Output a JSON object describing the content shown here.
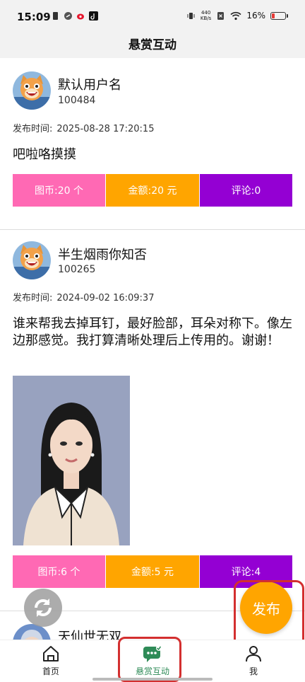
{
  "status_bar": {
    "time": "15:09",
    "net_speed_value": "440",
    "net_speed_unit": "KB/s",
    "battery_percent": "16%"
  },
  "header": {
    "title": "悬赏互动"
  },
  "posts": [
    {
      "username": "默认用户名",
      "user_id": "100484",
      "time_label": "发布时间:",
      "time": "2025-08-28 17:20:15",
      "content": "吧啦咯摸摸",
      "coins": "图币:20 个",
      "amount": "金额:20 元",
      "comments": "评论:0"
    },
    {
      "username": "半生烟雨你知否",
      "user_id": "100265",
      "time_label": "发布时间:",
      "time": "2024-09-02 16:09:37",
      "content": "谁来帮我去掉耳钉，最好脸部，耳朵对称下。像左边那感觉。我打算清晰处理后上传用的。谢谢！",
      "coins": "图币:6 个",
      "amount": "金额:5 元",
      "comments": "评论:4"
    },
    {
      "username": "天仙世无双"
    }
  ],
  "fab": {
    "label": "发布"
  },
  "bottom_nav": {
    "items": [
      {
        "label": "首页",
        "active": false
      },
      {
        "label": "悬赏互动",
        "active": true
      },
      {
        "label": "我",
        "active": false
      }
    ]
  },
  "colors": {
    "coins_bg": "#ff69b4",
    "amount_bg": "#ffa500",
    "comments_bg": "#9400d3",
    "fab_bg": "#ffa500",
    "active_nav": "#2e8b57",
    "highlight": "#d32f2f"
  }
}
